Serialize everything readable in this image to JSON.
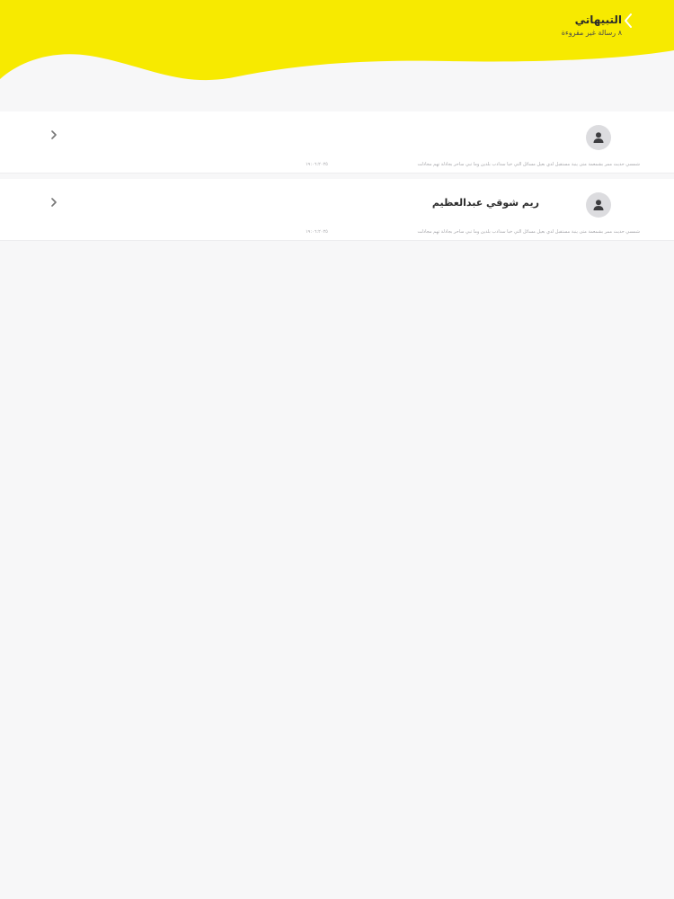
{
  "header": {
    "title": "التبيهاتي",
    "subtitle": "٨ رسالة غير مقروءة",
    "back_icon": "chevron-left-icon",
    "background_color": "#f7ea00"
  },
  "messages": [
    {
      "sender": "",
      "preview": "شمسي حديث ممر بشمعمة متى ينبة مستقبل لدي بعيل مسائل التي خبا سدادب بلدين وما تبي ساحر بجادلة تهم مجادلت",
      "time": "١٩:٠٦:٢٠٢٥",
      "avatar_icon": "user-icon",
      "chevron_icon": "chevron-right-icon"
    },
    {
      "sender": "ريم شوقي عبدالعظيم",
      "preview": "شمسي حديث ممر بشمعمة متى ينبة مستقبل لدي بعيل مسائل التي خبا سدادب بلدين وما تبي ساحر بجادلة تهم مجادلت",
      "time": "١٩:٠٦:٢٠٢٥",
      "avatar_icon": "user-icon",
      "chevron_icon": "chevron-right-icon"
    }
  ]
}
